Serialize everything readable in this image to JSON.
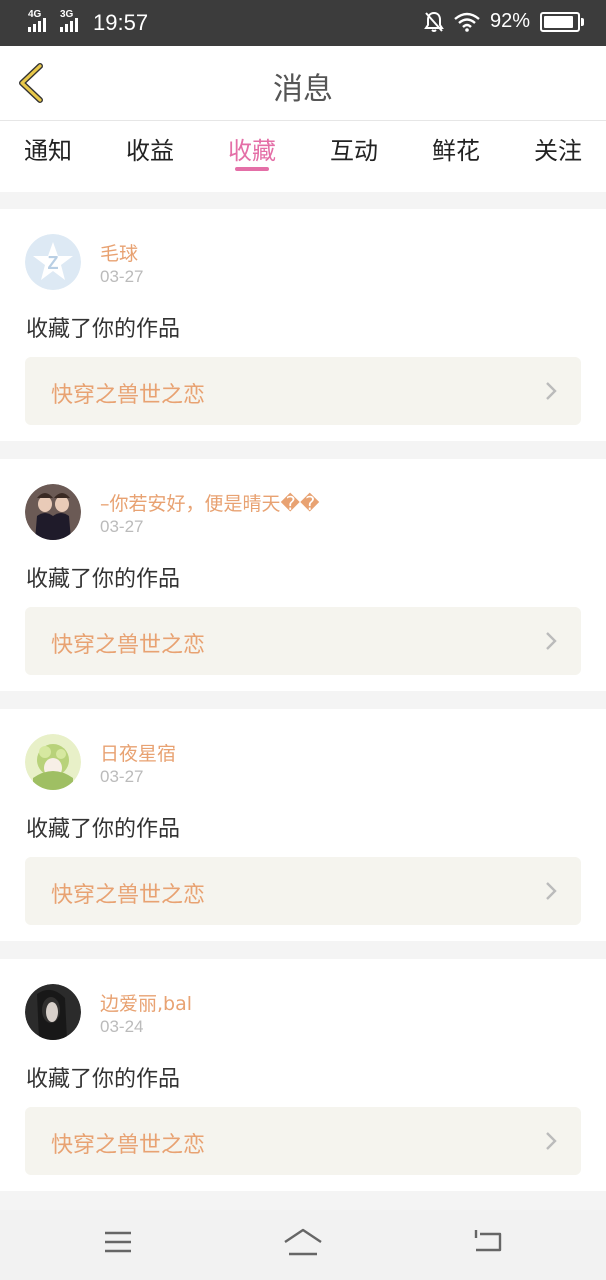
{
  "status_bar": {
    "network1": "4G",
    "network2": "3G",
    "time": "19:57",
    "battery_percent": "92%",
    "battery_level": 0.92
  },
  "header": {
    "title": "消息"
  },
  "tabs": [
    {
      "label": "通知",
      "active": false
    },
    {
      "label": "收益",
      "active": false
    },
    {
      "label": "收藏",
      "active": true
    },
    {
      "label": "互动",
      "active": false
    },
    {
      "label": "鲜花",
      "active": false
    },
    {
      "label": "关注",
      "active": false
    }
  ],
  "notifications": [
    {
      "user": "毛球",
      "date": "03-27",
      "action": "收藏了你的作品",
      "work_title": "快穿之兽世之恋"
    },
    {
      "user": "–你若安好，便是晴天��",
      "date": "03-27",
      "action": "收藏了你的作品",
      "work_title": "快穿之兽世之恋"
    },
    {
      "user": "日夜星宿",
      "date": "03-27",
      "action": "收藏了你的作品",
      "work_title": "快穿之兽世之恋"
    },
    {
      "user": "边爱丽,bal",
      "date": "03-24",
      "action": "收藏了你的作品",
      "work_title": "快穿之兽世之恋"
    }
  ],
  "colors": {
    "accent_pink": "#e46fa7",
    "name_orange": "#e8a272",
    "back_arrow": "#e8c84a"
  }
}
